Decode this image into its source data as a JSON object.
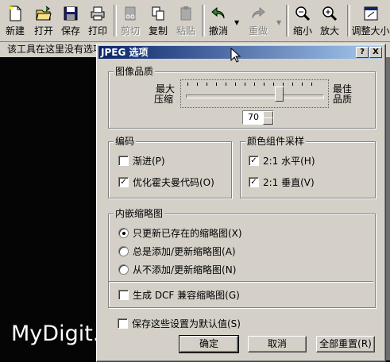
{
  "toolbar": {
    "new": "新建",
    "open": "打开",
    "save": "保存",
    "print": "打印",
    "cut": "剪切",
    "copy": "复制",
    "paste": "粘贴",
    "undo": "撤消",
    "redo": "重做",
    "zoom_out": "缩小",
    "zoom_in": "放大",
    "resize": "调整大小"
  },
  "infobar": {
    "text": "该工具在这里没有选项"
  },
  "dialog": {
    "title": "JPEG 选项",
    "help_btn": "?",
    "close_btn": "X",
    "quality": {
      "group_title": "图像品质",
      "left_label_1": "最大",
      "left_label_2": "压缩",
      "right_label_1": "最佳",
      "right_label_2": "品质",
      "value": "70",
      "slider_fraction": 0.68
    },
    "encoding": {
      "group_title": "编码",
      "progressive": "渐进(P)",
      "progressive_checked": false,
      "huffman": "优化霍夫曼代码(O)",
      "huffman_checked": true
    },
    "sampling": {
      "group_title": "颜色组件采样",
      "horizontal": "2:1 水平(H)",
      "horizontal_checked": true,
      "vertical": "2:1 垂直(V)",
      "vertical_checked": true
    },
    "thumbnail": {
      "group_title": "内嵌缩略图",
      "opt1": "只更新已存在的缩略图(X)",
      "opt2": "总是添加/更新缩略图(A)",
      "opt3": "从不添加/更新缩略图(N)",
      "selected": 1,
      "dcf": "生成 DCF 兼容缩略图(G)",
      "dcf_checked": false
    },
    "save_default": "保存这些设置为默认值(S)",
    "ok": "确定",
    "cancel": "取消",
    "reset": "全部重置(R)"
  },
  "watermark": "MyDigit.net"
}
